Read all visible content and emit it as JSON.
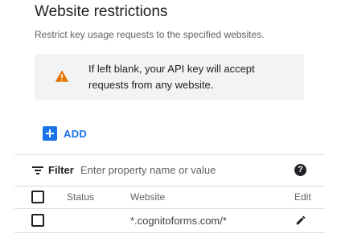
{
  "section": {
    "title": "Website restrictions",
    "subtitle": "Restrict key usage requests to the specified websites."
  },
  "warning": {
    "icon": "warning-icon",
    "color": "#e37400",
    "text": "If left blank, your API key will accept requests from any website."
  },
  "add_button": {
    "label": "ADD",
    "icon": "add-box-icon",
    "color": "#1a73e8"
  },
  "filter": {
    "label": "Filter",
    "placeholder": "Enter property name or value",
    "icon": "filter-icon",
    "help_icon": "help-icon"
  },
  "table": {
    "columns": [
      "Status",
      "Website",
      "Edit"
    ],
    "rows": [
      {
        "status": "",
        "website": "*.cognitoforms.com/*",
        "edit_icon": "pencil-icon"
      }
    ]
  }
}
